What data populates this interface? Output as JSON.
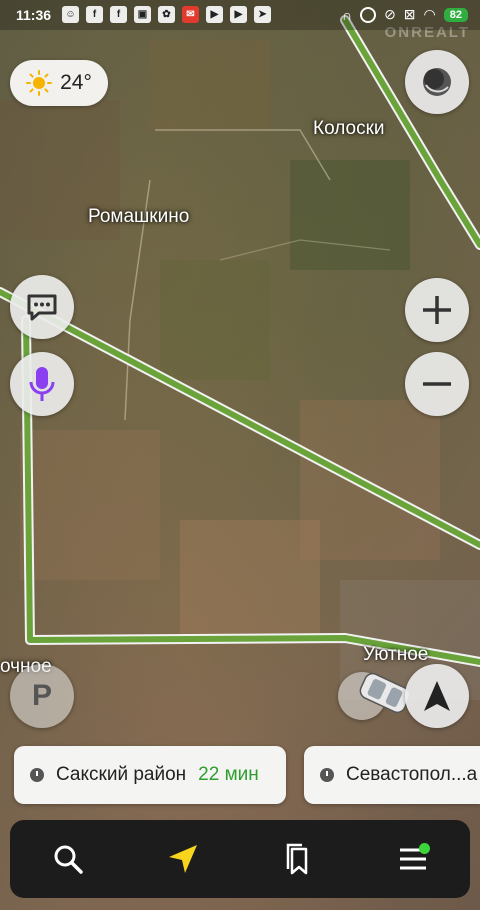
{
  "status_bar": {
    "time": "11:36",
    "battery": "82",
    "app_icons": [
      "notification-icon",
      "facebook-icon",
      "facebook-icon",
      "scan-icon",
      "pinwheel-icon",
      "mail-icon",
      "youtube-icon",
      "youtube-icon",
      "send-icon"
    ]
  },
  "weather": {
    "temperature": "24°",
    "icon": "sun-icon"
  },
  "map": {
    "places": {
      "kolosky": "Колоски",
      "romashkino": "Ромашкино",
      "utnoe": "Уютное",
      "left_edge": "очное"
    },
    "watermark": "ONREALT",
    "route_color": "#6aa33a"
  },
  "controls": {
    "layers": "layers-icon",
    "chat": "chat-bubble-icon",
    "voice": "microphone-icon",
    "zoom_in": "plus-icon",
    "zoom_out": "minus-icon",
    "parking_label": "P",
    "navigate": "navigation-arrow-icon"
  },
  "routes": [
    {
      "destination": "Сакский район",
      "eta": "22 мин"
    },
    {
      "destination": "Севастопол...а",
      "eta": ""
    }
  ],
  "nav_bar": {
    "items": [
      "search-icon",
      "navigation-icon",
      "bookmarks-icon",
      "menu-icon"
    ],
    "menu_notification_color": "#3bd43b"
  }
}
